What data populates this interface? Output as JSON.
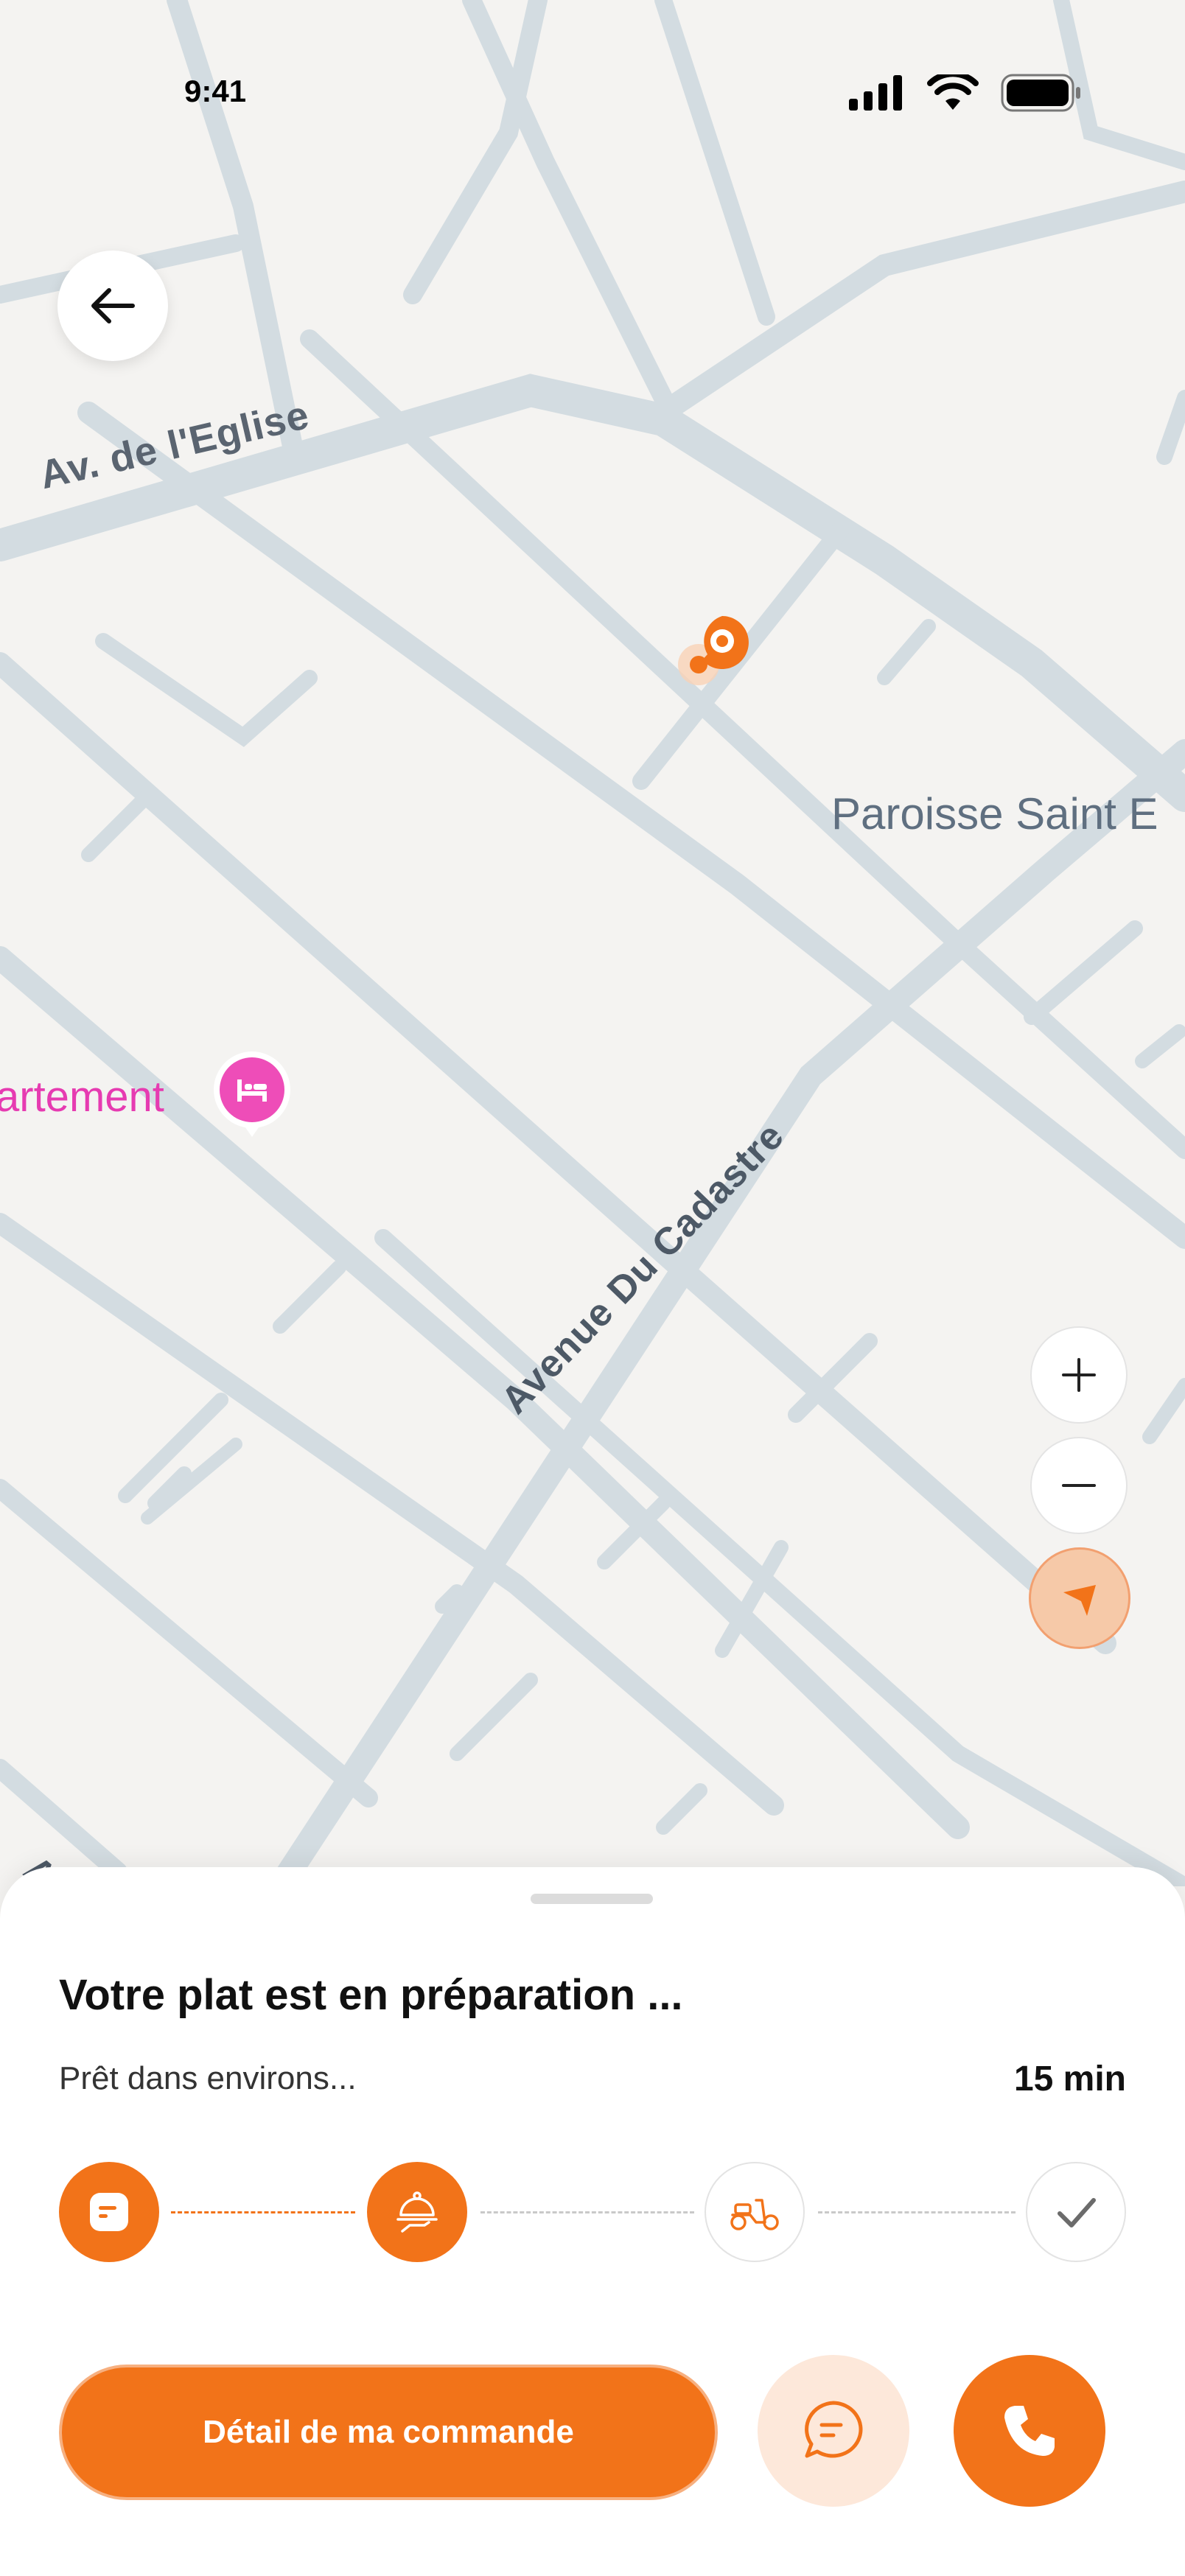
{
  "status_bar": {
    "time": "9:41"
  },
  "map": {
    "labels": {
      "street_eglise": "Av. de l'Eglise",
      "place_paroisse": "Paroisse Saint E",
      "place_appartement": "artement",
      "street_cadastre": "Avenue Du Cadastre",
      "street_partial": "Av"
    },
    "icons": {
      "back": "arrow-left-icon",
      "zoom_in": "plus-icon",
      "zoom_out": "minus-icon",
      "locate": "location-arrow-icon",
      "hotel": "bed-icon",
      "destination": "location-pin-icon"
    }
  },
  "sheet": {
    "title": "Votre plat est en préparation ...",
    "eta_label": "Prêt dans environs...",
    "eta_value": "15 min",
    "steps": [
      {
        "name": "order-received",
        "icon": "receipt-icon",
        "state": "done"
      },
      {
        "name": "preparing",
        "icon": "serving-dish-icon",
        "state": "done"
      },
      {
        "name": "delivering",
        "icon": "scooter-icon",
        "state": "pending"
      },
      {
        "name": "delivered",
        "icon": "check-icon",
        "state": "pending"
      }
    ],
    "detail_button": "Détail de ma commande",
    "chat_icon": "chat-bubble-icon",
    "call_icon": "phone-icon"
  },
  "colors": {
    "accent": "#f27319",
    "accent_light": "#fde8da",
    "map_background": "#f4f3f1",
    "road": "#d3dce1",
    "hotel_pink": "#e63bb1"
  }
}
